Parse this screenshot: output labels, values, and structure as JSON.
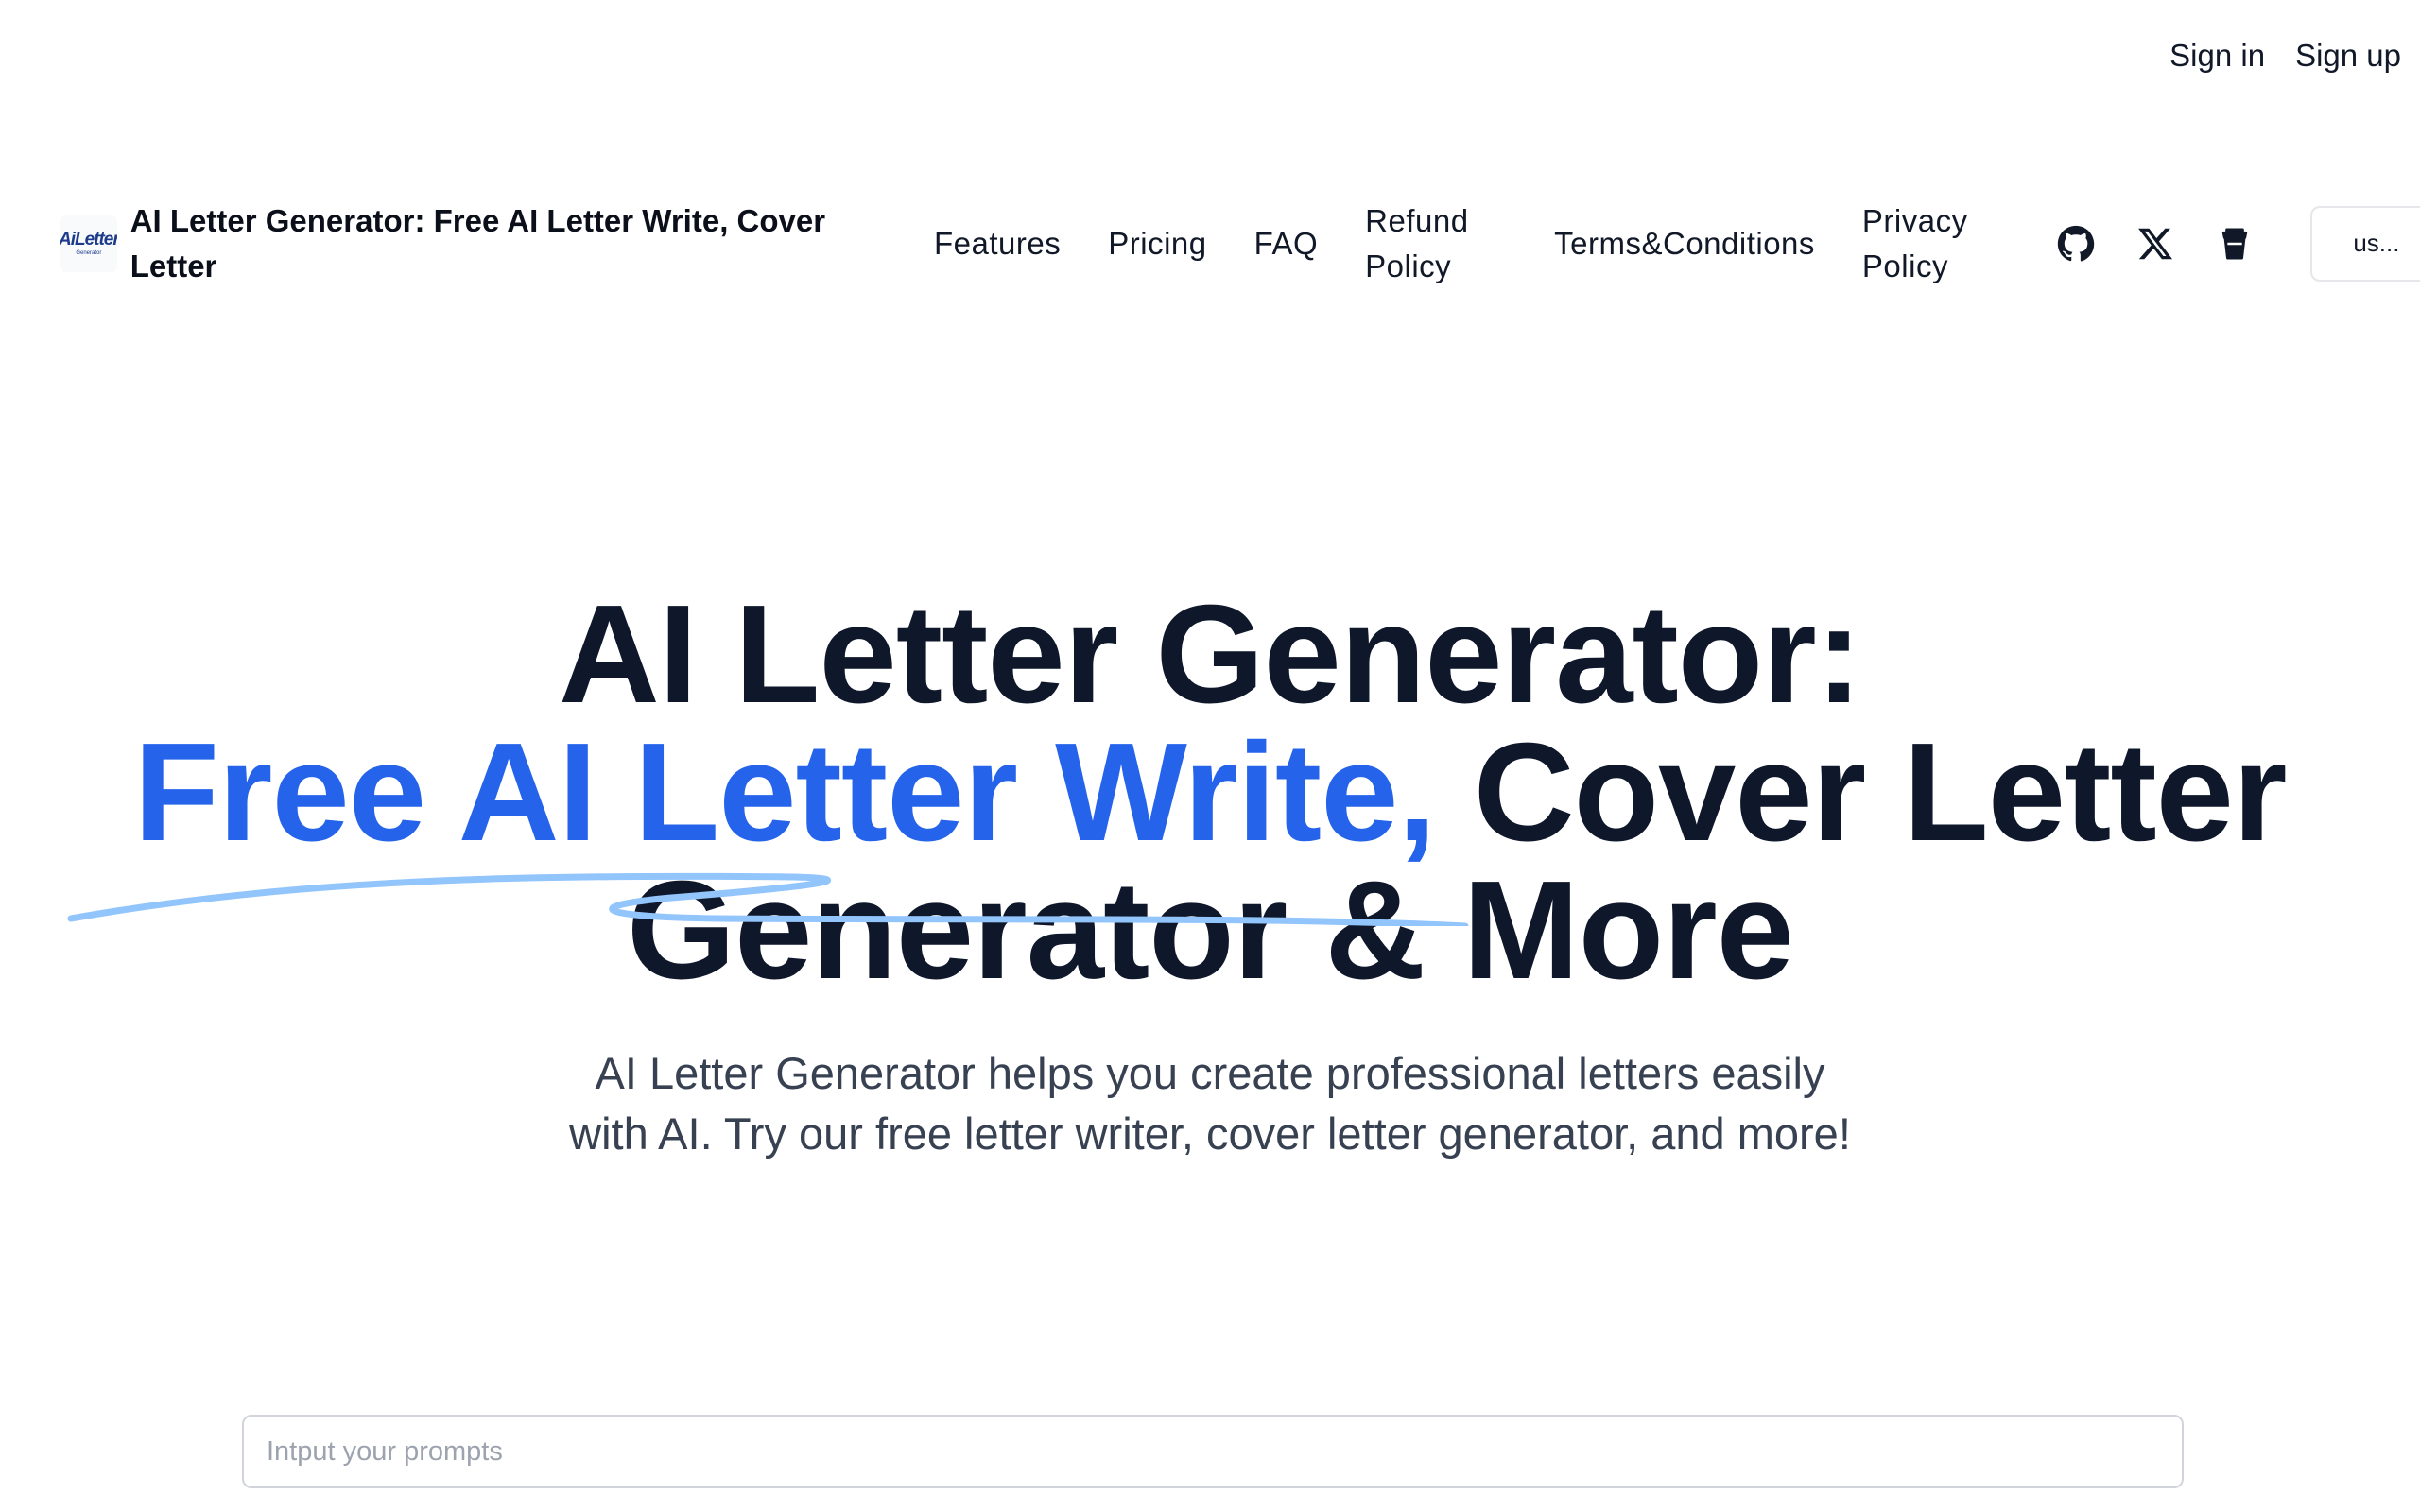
{
  "auth": {
    "sign_in": "Sign in",
    "sign_up": "Sign up"
  },
  "brand": {
    "logo_text": "AiLetter",
    "logo_subtext": "Generator",
    "title": "AI Letter Generator: Free AI Letter Write, Cover Letter"
  },
  "nav": {
    "items": [
      {
        "label": "Features"
      },
      {
        "label": "Pricing"
      },
      {
        "label": "FAQ"
      },
      {
        "label": "Refund Policy"
      },
      {
        "label": "Terms&Conditions"
      },
      {
        "label": "Privacy Policy"
      }
    ],
    "icons": [
      "github-icon",
      "x-twitter-icon",
      "coffee-cup-icon"
    ],
    "language": "us..."
  },
  "hero": {
    "line1": "AI Letter Generator:",
    "line2_accent": "Free AI Letter Write,",
    "line2_rest": " Cover Letter",
    "line3": "Generator & More",
    "subtitle": "AI Letter Generator helps you create professional letters easily with AI. Try our free letter writer, cover letter generator, and more!"
  },
  "prompt": {
    "placeholder": "Intput your prompts",
    "value": ""
  },
  "colors": {
    "accent": "#2563eb",
    "text": "#0f172a",
    "underline": "#93c5fd"
  }
}
